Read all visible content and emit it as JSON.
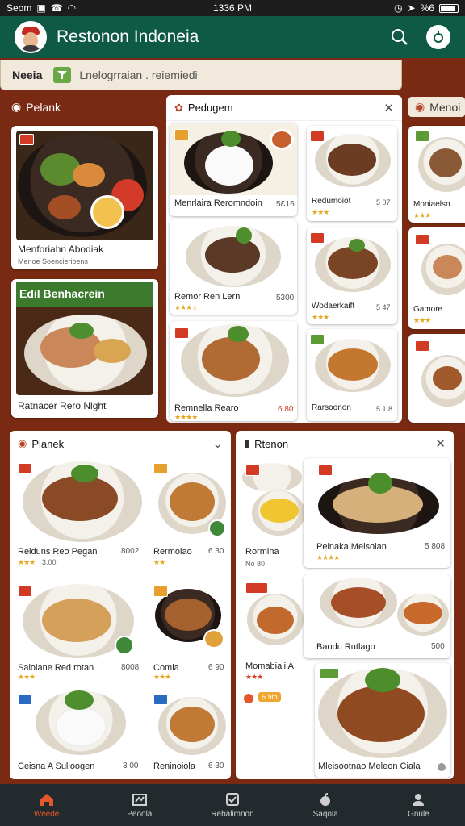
{
  "status": {
    "left": "Seom",
    "time": "1336 PM",
    "battery": "%6"
  },
  "header": {
    "title": "Restonon Indoneia",
    "icons": [
      "search-icon",
      "settings-icon"
    ]
  },
  "search": {
    "label": "Neeia",
    "query": "Lnelogrraian . reiemiedi"
  },
  "sections": {
    "top_left": "Pelank",
    "top_middle": "Pedugem",
    "top_right": "Menoi",
    "bottom_left": "Planek",
    "bottom_right": "Rtenon"
  },
  "cards": {
    "tl1": {
      "name": "Menforiahn Abodiak",
      "sub": "Menoe Soencierioens"
    },
    "tl2": {
      "banner": "Edil Benhacrein",
      "name": "Ratnacer Rero Nlght"
    },
    "tm1": {
      "name": "Menrlaira Reromndoin",
      "price": "5Ɛ16"
    },
    "tm2": {
      "name": "Remor Ren Lern",
      "price": "5300"
    },
    "tm3": {
      "name": "Remnella Rearo",
      "price": "6 80"
    },
    "tm4": {
      "name": "Redumoiot",
      "price": "5 07"
    },
    "tm5": {
      "name": "Wodaerkaift",
      "price": "5 47"
    },
    "tm6": {
      "name": "Rarsoonon",
      "price": "5 1 8"
    },
    "tr1": {
      "name": "Moniaelsn"
    },
    "tr2": {
      "name": "Gamore"
    },
    "bl1": {
      "name": "Relduns Reo Pegan",
      "price": "8002",
      "rating": "3.00"
    },
    "bl2": {
      "name": "Rermolao",
      "price": "6 30"
    },
    "bl3": {
      "name": "Salolane Red rotan",
      "price": "8008"
    },
    "bl4": {
      "name": "Comia",
      "price": "6 90"
    },
    "bl5": {
      "name": "Ceisna A Sulloogen",
      "price": "3 00"
    },
    "bl6": {
      "name": "Reninoiola",
      "price": "6 30"
    },
    "br1": {
      "name": "Rormiha",
      "sub": "No 80"
    },
    "br2": {
      "name": "Pelnaka Melsolan",
      "price": "5 808"
    },
    "br3": {
      "name": "Momabiali A",
      "chip": "6 9lb"
    },
    "br4": {
      "name": "Baodu Rutlago",
      "price": "500"
    },
    "br5": {
      "name": "Mleisootnao Meleon Ciala"
    }
  },
  "nav": [
    {
      "label": "Weede",
      "icon": "home-icon"
    },
    {
      "label": "Peoola",
      "icon": "map-icon"
    },
    {
      "label": "Rebalimnon",
      "icon": "checklist-icon"
    },
    {
      "label": "Saqola",
      "icon": "apple-icon"
    },
    {
      "label": "Gnule",
      "icon": "profile-icon"
    }
  ],
  "colors": {
    "brand": "#0f5a45",
    "background": "#7a2a12",
    "accent": "#e4572b"
  }
}
